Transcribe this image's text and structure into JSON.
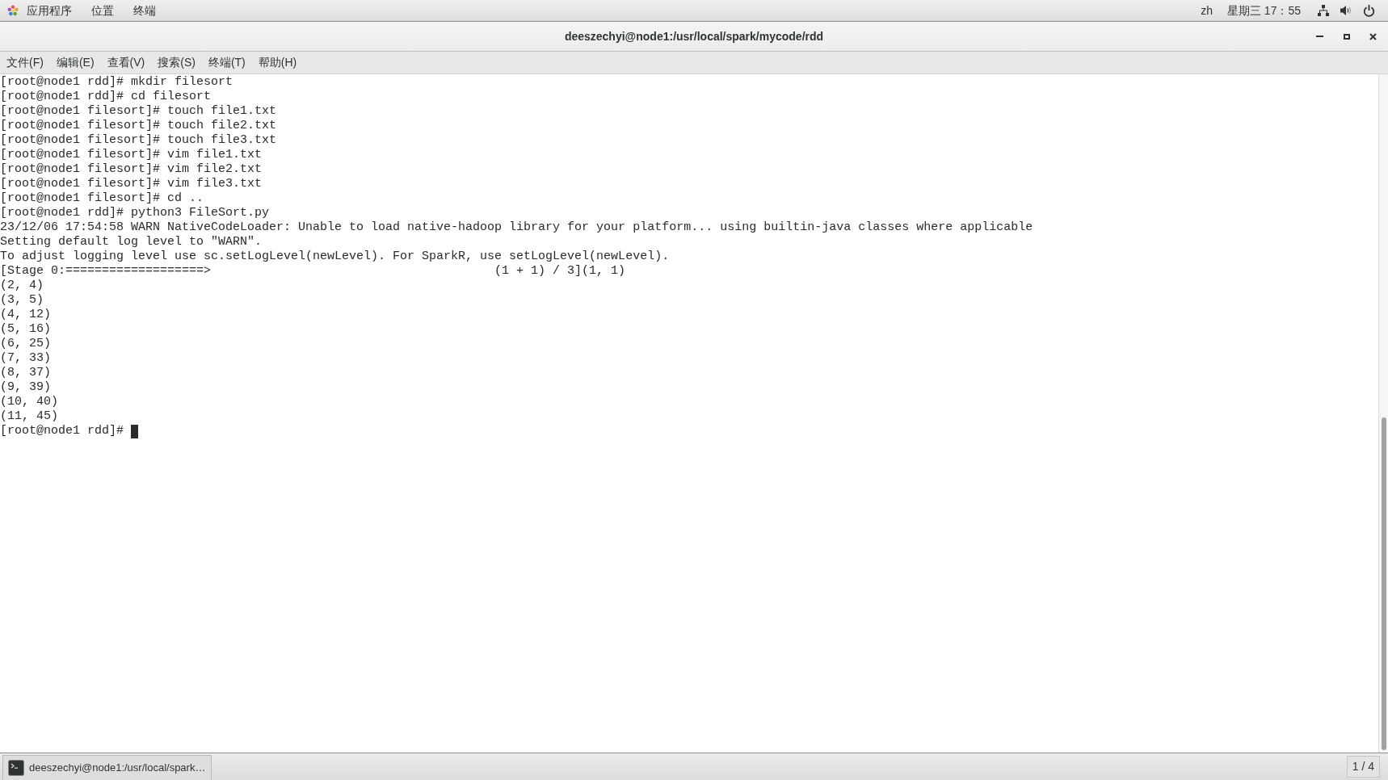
{
  "top_bar": {
    "menus": [
      "应用程序",
      "位置",
      "终端"
    ],
    "input_method": "zh",
    "clock": "星期三 17：55"
  },
  "window": {
    "title": "deeszechyi@node1:/usr/local/spark/mycode/rdd"
  },
  "menu_bar": [
    "文件(F)",
    "编辑(E)",
    "查看(V)",
    "搜索(S)",
    "终端(T)",
    "帮助(H)"
  ],
  "terminal": {
    "lines": [
      "[root@node1 rdd]# mkdir filesort",
      "[root@node1 rdd]# cd filesort",
      "[root@node1 filesort]# touch file1.txt",
      "[root@node1 filesort]# touch file2.txt",
      "[root@node1 filesort]# touch file3.txt",
      "[root@node1 filesort]# vim file1.txt",
      "[root@node1 filesort]# vim file2.txt",
      "[root@node1 filesort]# vim file3.txt",
      "[root@node1 filesort]# cd ..",
      "[root@node1 rdd]# python3 FileSort.py",
      "23/12/06 17:54:58 WARN NativeCodeLoader: Unable to load native-hadoop library for your platform... using builtin-java classes where applicable",
      "Setting default log level to \"WARN\".",
      "To adjust logging level use sc.setLogLevel(newLevel). For SparkR, use setLogLevel(newLevel).",
      "[Stage 0:===================>                                       (1 + 1) / 3](1, 1)",
      "(2, 4)",
      "(3, 5)",
      "(4, 12)",
      "(5, 16)",
      "(6, 25)",
      "(7, 33)",
      "(8, 37)",
      "(9, 39)",
      "(10, 40)",
      "(11, 45)",
      "[root@node1 rdd]#"
    ]
  },
  "taskbar": {
    "tasks": [
      {
        "label": "deeszechyi@node1:/usr/local/spark…",
        "selected": true
      }
    ],
    "workspace": "1 / 4"
  }
}
